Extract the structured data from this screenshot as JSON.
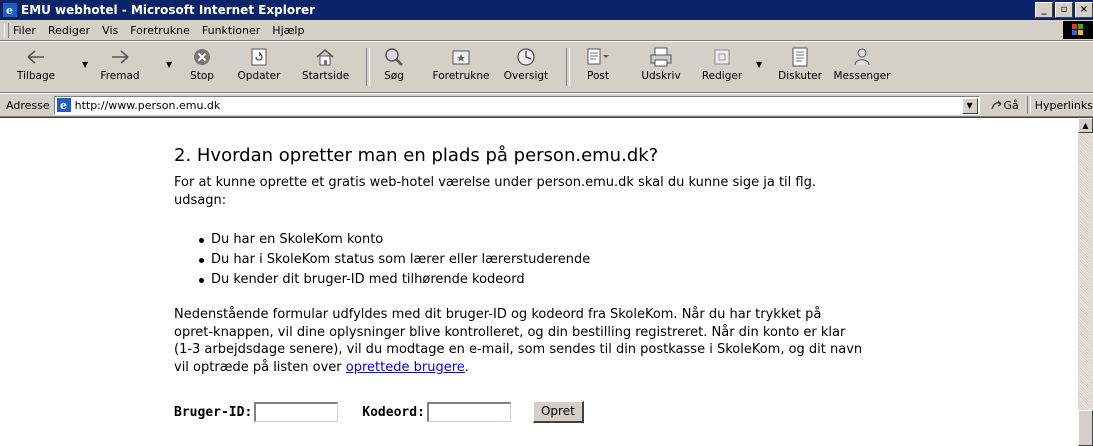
{
  "window": {
    "title": "EMU webhotel - Microsoft Internet Explorer"
  },
  "menu": [
    {
      "label": "Filer"
    },
    {
      "label": "Rediger"
    },
    {
      "label": "Vis"
    },
    {
      "label": "Foretrukne"
    },
    {
      "label": "Funktioner"
    },
    {
      "label": "Hjælp"
    }
  ],
  "toolbar": {
    "back": "Tilbage",
    "forward": "Fremad",
    "stop": "Stop",
    "refresh": "Opdater",
    "home": "Startside",
    "search": "Søg",
    "favorites": "Foretrukne",
    "history": "Oversigt",
    "mail": "Post",
    "print": "Udskriv",
    "edit": "Rediger",
    "discuss": "Diskuter",
    "messenger": "Messenger"
  },
  "address": {
    "label": "Adresse",
    "url": "http://www.person.emu.dk",
    "go": "Gå",
    "links": "Hyperlinks"
  },
  "page": {
    "heading": "2. Hvordan opretter man en plads på person.emu.dk?",
    "intro": "For at kunne oprette et gratis web-hotel værelse under person.emu.dk skal du kunne sige ja til flg. udsagn:",
    "bullets": [
      "Du har en SkoleKom konto",
      "Du har i SkoleKom status som lærer eller lærerstuderende",
      "Du kender dit bruger-ID med tilhørende kodeord"
    ],
    "body": "Nedenstående formular udfyldes med dit bruger-ID og kodeord fra SkoleKom. Når du har trykket på opret-knappen, vil dine oplysninger blive kontrolleret, og din bestilling registreret. Når din konto er klar (1-3 arbejdsdage senere), vil du modtage en e-mail, som sendes til din postkasse i SkoleKom, og dit navn vil optræde på listen over",
    "link": "oprettede brugere",
    "link_suffix": ".",
    "form": {
      "user_label": "Bruger-ID:",
      "user_value": "",
      "pass_label": "Kodeord:",
      "pass_value": "",
      "submit": "Opret"
    }
  }
}
